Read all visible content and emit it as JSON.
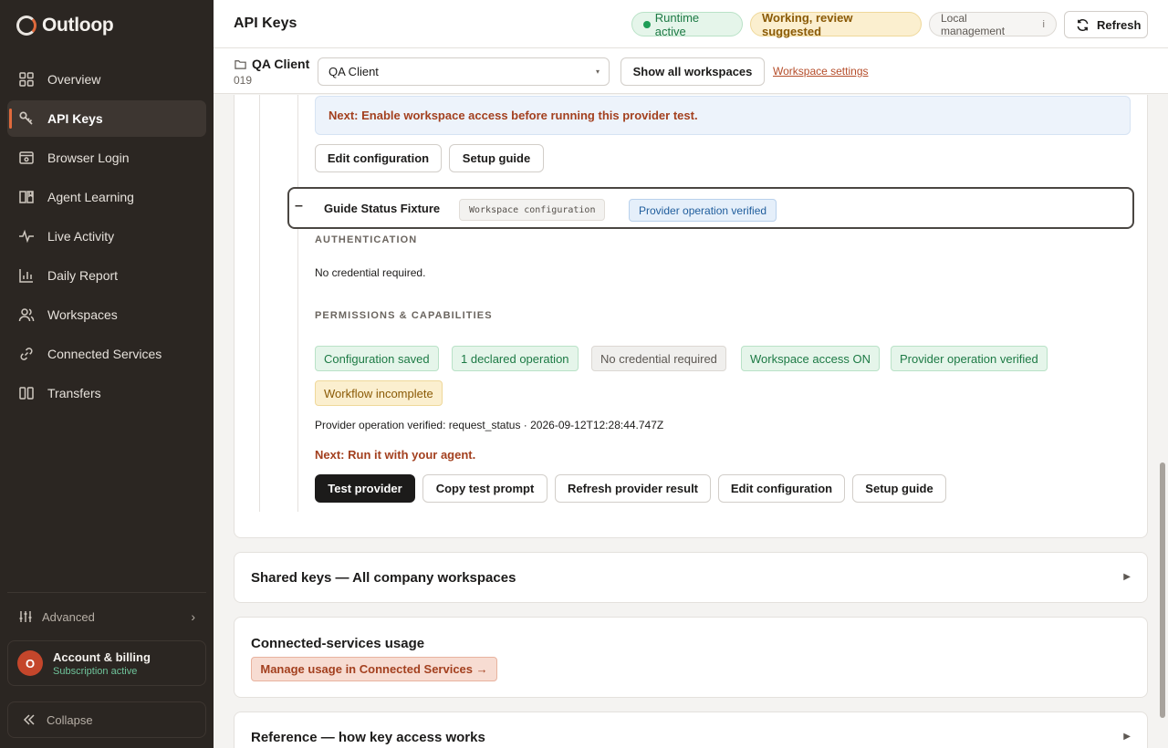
{
  "app": {
    "name": "Outloop"
  },
  "sidebar": {
    "items": [
      {
        "label": "Overview",
        "icon": "grid-icon"
      },
      {
        "label": "API Keys",
        "icon": "key-icon",
        "active": true
      },
      {
        "label": "Browser Login",
        "icon": "browser-icon"
      },
      {
        "label": "Agent Learning",
        "icon": "book-icon"
      },
      {
        "label": "Live Activity",
        "icon": "pulse-icon"
      },
      {
        "label": "Daily Report",
        "icon": "bar-chart-icon"
      },
      {
        "label": "Workspaces",
        "icon": "users-icon"
      },
      {
        "label": "Connected Services",
        "icon": "link-icon"
      },
      {
        "label": "Transfers",
        "icon": "transfer-icon"
      }
    ],
    "advanced_label": "Advanced",
    "account": {
      "initial": "O",
      "title": "Account & billing",
      "status": "Subscription active"
    },
    "collapse_label": "Collapse"
  },
  "header": {
    "title": "API Keys",
    "runtime_label": "Runtime active",
    "working_label": "Working, review suggested",
    "local_label": "Local management",
    "local_info": "i",
    "refresh_label": "Refresh"
  },
  "workspace_bar": {
    "name": "QA Client",
    "id": "019",
    "selected": "QA Client",
    "show_all_label": "Show all workspaces",
    "settings_label": "Workspace settings"
  },
  "provider_above": {
    "next_banner": "Next: Enable workspace access before running this provider test.",
    "edit_label": "Edit configuration",
    "guide_label": "Setup guide"
  },
  "fixture": {
    "toggle": "–",
    "title": "Guide Status Fixture",
    "tag": "Workspace configuration",
    "verified_badge": "Provider operation verified",
    "auth_heading": "AUTHENTICATION",
    "auth_text": "No credential required.",
    "perm_heading": "PERMISSIONS & CAPABILITIES",
    "chips": [
      {
        "label": "Configuration saved",
        "tone": "green"
      },
      {
        "label": "1 declared operation",
        "tone": "green"
      },
      {
        "label": "No credential required",
        "tone": "grey"
      },
      {
        "label": "Workspace access ON",
        "tone": "green"
      },
      {
        "label": "Provider operation verified",
        "tone": "green"
      },
      {
        "label": "Workflow incomplete",
        "tone": "amber"
      }
    ],
    "verified_line": "Provider operation verified: request_status · 2026-09-12T12:28:44.747Z",
    "next_step": "Next: Run it with your agent.",
    "actions": {
      "test": "Test provider",
      "copy": "Copy test prompt",
      "refresh": "Refresh provider result",
      "edit": "Edit configuration",
      "guide": "Setup guide"
    }
  },
  "sections": {
    "shared_title": "Shared keys — All company workspaces",
    "usage_title": "Connected-services usage",
    "usage_link": "Manage usage in Connected Services →",
    "reference_title": "Reference — how key access works"
  },
  "colors": {
    "sidebar_bg": "#2b2622",
    "accent": "#e06a3c",
    "success": "#1d7a45",
    "warning": "#8a5a06",
    "next_step": "#a3401f"
  }
}
